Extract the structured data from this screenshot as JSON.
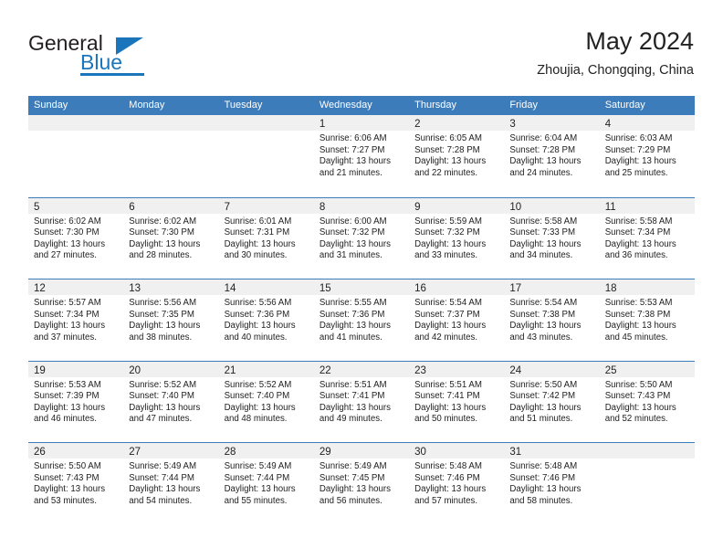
{
  "brand": {
    "name_top": "General",
    "name_bottom": "Blue",
    "accent_color": "#1b75bb"
  },
  "header": {
    "title": "May 2024",
    "location": "Zhoujia, Chongqing, China"
  },
  "calendar": {
    "header_color": "#3c7cba",
    "day_strip_color": "#f0f0f0",
    "weekdays": [
      "Sunday",
      "Monday",
      "Tuesday",
      "Wednesday",
      "Thursday",
      "Friday",
      "Saturday"
    ],
    "weeks": [
      [
        {
          "day": "",
          "sunrise": "",
          "sunset": "",
          "daylight1": "",
          "daylight2": "",
          "empty": true
        },
        {
          "day": "",
          "sunrise": "",
          "sunset": "",
          "daylight1": "",
          "daylight2": "",
          "empty": true
        },
        {
          "day": "",
          "sunrise": "",
          "sunset": "",
          "daylight1": "",
          "daylight2": "",
          "empty": true
        },
        {
          "day": "1",
          "sunrise": "Sunrise: 6:06 AM",
          "sunset": "Sunset: 7:27 PM",
          "daylight1": "Daylight: 13 hours",
          "daylight2": "and 21 minutes."
        },
        {
          "day": "2",
          "sunrise": "Sunrise: 6:05 AM",
          "sunset": "Sunset: 7:28 PM",
          "daylight1": "Daylight: 13 hours",
          "daylight2": "and 22 minutes."
        },
        {
          "day": "3",
          "sunrise": "Sunrise: 6:04 AM",
          "sunset": "Sunset: 7:28 PM",
          "daylight1": "Daylight: 13 hours",
          "daylight2": "and 24 minutes."
        },
        {
          "day": "4",
          "sunrise": "Sunrise: 6:03 AM",
          "sunset": "Sunset: 7:29 PM",
          "daylight1": "Daylight: 13 hours",
          "daylight2": "and 25 minutes."
        }
      ],
      [
        {
          "day": "5",
          "sunrise": "Sunrise: 6:02 AM",
          "sunset": "Sunset: 7:30 PM",
          "daylight1": "Daylight: 13 hours",
          "daylight2": "and 27 minutes."
        },
        {
          "day": "6",
          "sunrise": "Sunrise: 6:02 AM",
          "sunset": "Sunset: 7:30 PM",
          "daylight1": "Daylight: 13 hours",
          "daylight2": "and 28 minutes."
        },
        {
          "day": "7",
          "sunrise": "Sunrise: 6:01 AM",
          "sunset": "Sunset: 7:31 PM",
          "daylight1": "Daylight: 13 hours",
          "daylight2": "and 30 minutes."
        },
        {
          "day": "8",
          "sunrise": "Sunrise: 6:00 AM",
          "sunset": "Sunset: 7:32 PM",
          "daylight1": "Daylight: 13 hours",
          "daylight2": "and 31 minutes."
        },
        {
          "day": "9",
          "sunrise": "Sunrise: 5:59 AM",
          "sunset": "Sunset: 7:32 PM",
          "daylight1": "Daylight: 13 hours",
          "daylight2": "and 33 minutes."
        },
        {
          "day": "10",
          "sunrise": "Sunrise: 5:58 AM",
          "sunset": "Sunset: 7:33 PM",
          "daylight1": "Daylight: 13 hours",
          "daylight2": "and 34 minutes."
        },
        {
          "day": "11",
          "sunrise": "Sunrise: 5:58 AM",
          "sunset": "Sunset: 7:34 PM",
          "daylight1": "Daylight: 13 hours",
          "daylight2": "and 36 minutes."
        }
      ],
      [
        {
          "day": "12",
          "sunrise": "Sunrise: 5:57 AM",
          "sunset": "Sunset: 7:34 PM",
          "daylight1": "Daylight: 13 hours",
          "daylight2": "and 37 minutes."
        },
        {
          "day": "13",
          "sunrise": "Sunrise: 5:56 AM",
          "sunset": "Sunset: 7:35 PM",
          "daylight1": "Daylight: 13 hours",
          "daylight2": "and 38 minutes."
        },
        {
          "day": "14",
          "sunrise": "Sunrise: 5:56 AM",
          "sunset": "Sunset: 7:36 PM",
          "daylight1": "Daylight: 13 hours",
          "daylight2": "and 40 minutes."
        },
        {
          "day": "15",
          "sunrise": "Sunrise: 5:55 AM",
          "sunset": "Sunset: 7:36 PM",
          "daylight1": "Daylight: 13 hours",
          "daylight2": "and 41 minutes."
        },
        {
          "day": "16",
          "sunrise": "Sunrise: 5:54 AM",
          "sunset": "Sunset: 7:37 PM",
          "daylight1": "Daylight: 13 hours",
          "daylight2": "and 42 minutes."
        },
        {
          "day": "17",
          "sunrise": "Sunrise: 5:54 AM",
          "sunset": "Sunset: 7:38 PM",
          "daylight1": "Daylight: 13 hours",
          "daylight2": "and 43 minutes."
        },
        {
          "day": "18",
          "sunrise": "Sunrise: 5:53 AM",
          "sunset": "Sunset: 7:38 PM",
          "daylight1": "Daylight: 13 hours",
          "daylight2": "and 45 minutes."
        }
      ],
      [
        {
          "day": "19",
          "sunrise": "Sunrise: 5:53 AM",
          "sunset": "Sunset: 7:39 PM",
          "daylight1": "Daylight: 13 hours",
          "daylight2": "and 46 minutes."
        },
        {
          "day": "20",
          "sunrise": "Sunrise: 5:52 AM",
          "sunset": "Sunset: 7:40 PM",
          "daylight1": "Daylight: 13 hours",
          "daylight2": "and 47 minutes."
        },
        {
          "day": "21",
          "sunrise": "Sunrise: 5:52 AM",
          "sunset": "Sunset: 7:40 PM",
          "daylight1": "Daylight: 13 hours",
          "daylight2": "and 48 minutes."
        },
        {
          "day": "22",
          "sunrise": "Sunrise: 5:51 AM",
          "sunset": "Sunset: 7:41 PM",
          "daylight1": "Daylight: 13 hours",
          "daylight2": "and 49 minutes."
        },
        {
          "day": "23",
          "sunrise": "Sunrise: 5:51 AM",
          "sunset": "Sunset: 7:41 PM",
          "daylight1": "Daylight: 13 hours",
          "daylight2": "and 50 minutes."
        },
        {
          "day": "24",
          "sunrise": "Sunrise: 5:50 AM",
          "sunset": "Sunset: 7:42 PM",
          "daylight1": "Daylight: 13 hours",
          "daylight2": "and 51 minutes."
        },
        {
          "day": "25",
          "sunrise": "Sunrise: 5:50 AM",
          "sunset": "Sunset: 7:43 PM",
          "daylight1": "Daylight: 13 hours",
          "daylight2": "and 52 minutes."
        }
      ],
      [
        {
          "day": "26",
          "sunrise": "Sunrise: 5:50 AM",
          "sunset": "Sunset: 7:43 PM",
          "daylight1": "Daylight: 13 hours",
          "daylight2": "and 53 minutes."
        },
        {
          "day": "27",
          "sunrise": "Sunrise: 5:49 AM",
          "sunset": "Sunset: 7:44 PM",
          "daylight1": "Daylight: 13 hours",
          "daylight2": "and 54 minutes."
        },
        {
          "day": "28",
          "sunrise": "Sunrise: 5:49 AM",
          "sunset": "Sunset: 7:44 PM",
          "daylight1": "Daylight: 13 hours",
          "daylight2": "and 55 minutes."
        },
        {
          "day": "29",
          "sunrise": "Sunrise: 5:49 AM",
          "sunset": "Sunset: 7:45 PM",
          "daylight1": "Daylight: 13 hours",
          "daylight2": "and 56 minutes."
        },
        {
          "day": "30",
          "sunrise": "Sunrise: 5:48 AM",
          "sunset": "Sunset: 7:46 PM",
          "daylight1": "Daylight: 13 hours",
          "daylight2": "and 57 minutes."
        },
        {
          "day": "31",
          "sunrise": "Sunrise: 5:48 AM",
          "sunset": "Sunset: 7:46 PM",
          "daylight1": "Daylight: 13 hours",
          "daylight2": "and 58 minutes."
        },
        {
          "day": "",
          "sunrise": "",
          "sunset": "",
          "daylight1": "",
          "daylight2": "",
          "empty": true
        }
      ]
    ]
  }
}
